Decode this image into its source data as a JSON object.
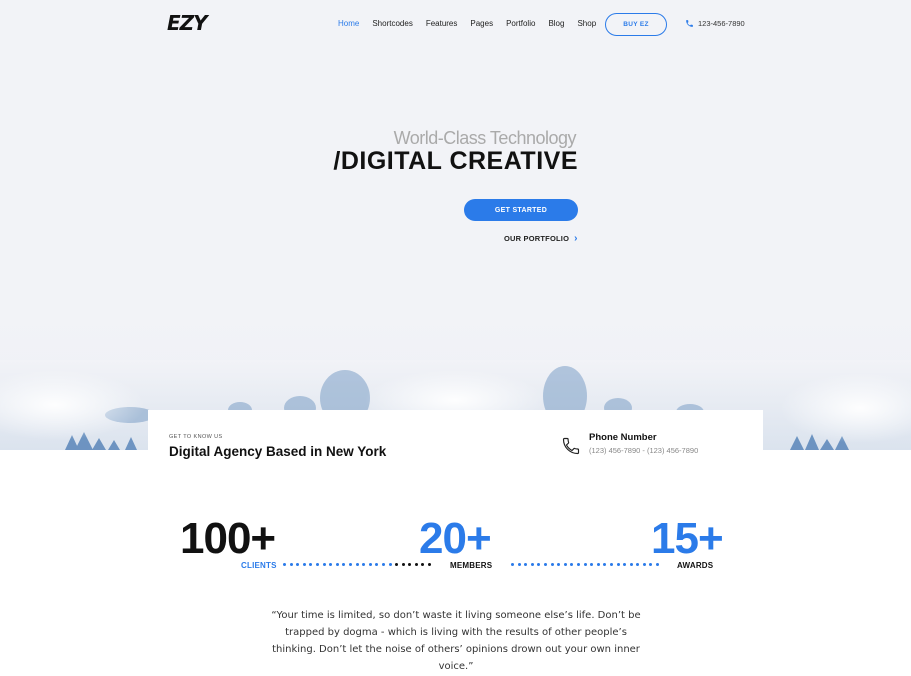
{
  "header": {
    "logo": "EZY",
    "nav": [
      "Home",
      "Shortcodes",
      "Features",
      "Pages",
      "Portfolio",
      "Blog",
      "Shop"
    ],
    "buy_label": "BUY EZ",
    "phone": "123-456-7890"
  },
  "hero": {
    "subtitle": "World-Class Technology",
    "title": "/DIGITAL CREATIVE",
    "cta_label": "GET STARTED",
    "portfolio_label": "OUR PORTFOLIO"
  },
  "info": {
    "eyebrow": "GET TO KNOW US",
    "agency_title": "Digital Agency Based in New York",
    "phone_label": "Phone Number",
    "phone_numbers": "(123) 456-7890 - (123) 456-7890"
  },
  "stats": [
    {
      "value": "100+",
      "label": "CLIENTS"
    },
    {
      "value": "20+",
      "label": "MEMBERS"
    },
    {
      "value": "15+",
      "label": "AWARDS"
    }
  ],
  "quote": "“Your time is limited, so don’t waste it living someone else’s life. Don’t be trapped by dogma - which is living with the results of other people’s thinking. Don’t let the noise of others’ opinions drown out your own inner voice.”",
  "colors": {
    "accent": "#2b7be9",
    "dark": "#111111"
  },
  "icons": {
    "phone": "phone-icon",
    "chevron": "chevron-right-icon"
  }
}
